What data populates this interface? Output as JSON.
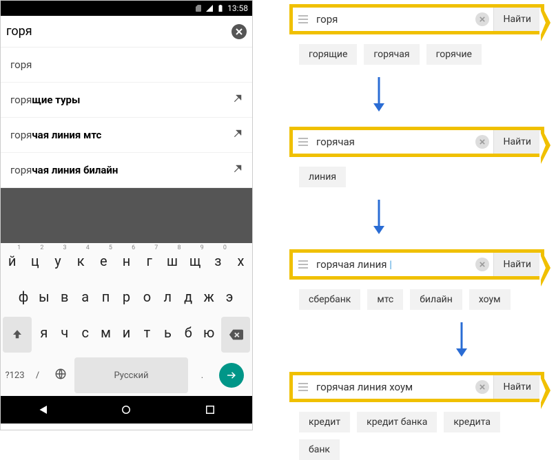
{
  "statusbar": {
    "time": "13:58"
  },
  "search": {
    "query": "горя"
  },
  "suggestions": [
    {
      "prefix": "горя",
      "rest": "",
      "has_arrow": false
    },
    {
      "prefix": "горя",
      "rest": "щие туры",
      "has_arrow": true
    },
    {
      "prefix": "горя",
      "rest": "чая линия мтс",
      "has_arrow": true
    },
    {
      "prefix": "горя",
      "rest": "чая линия билайн",
      "has_arrow": true
    }
  ],
  "keyboard": {
    "row1": [
      "й",
      "ц",
      "у",
      "к",
      "е",
      "н",
      "г",
      "ш",
      "щ",
      "з",
      "х"
    ],
    "nums": [
      "1",
      "2",
      "3",
      "4",
      "5",
      "6",
      "7",
      "8",
      "9",
      "0",
      ""
    ],
    "row2": [
      "ф",
      "ы",
      "в",
      "а",
      "п",
      "р",
      "о",
      "л",
      "д",
      "ж",
      "э"
    ],
    "row3": [
      "я",
      "ч",
      "с",
      "м",
      "и",
      "т",
      "ь",
      "б",
      "ю"
    ],
    "mode_key": "?123",
    "slash": "/",
    "space_label": "Русский",
    "dot": "."
  },
  "flow": [
    {
      "query": "горя",
      "chips": [
        "горящие",
        "горячая",
        "горячие"
      ]
    },
    {
      "query": "горячая",
      "chips": [
        "линия"
      ]
    },
    {
      "query": "горячая линия ",
      "cursor": true,
      "chips": [
        "сбербанк",
        "мтс",
        "билайн",
        "хоум"
      ]
    },
    {
      "query": "горячая линия хоум",
      "chips": [
        "кредит",
        "кредит банка",
        "кредита",
        "банк"
      ]
    }
  ],
  "labels": {
    "find": "Найти"
  }
}
